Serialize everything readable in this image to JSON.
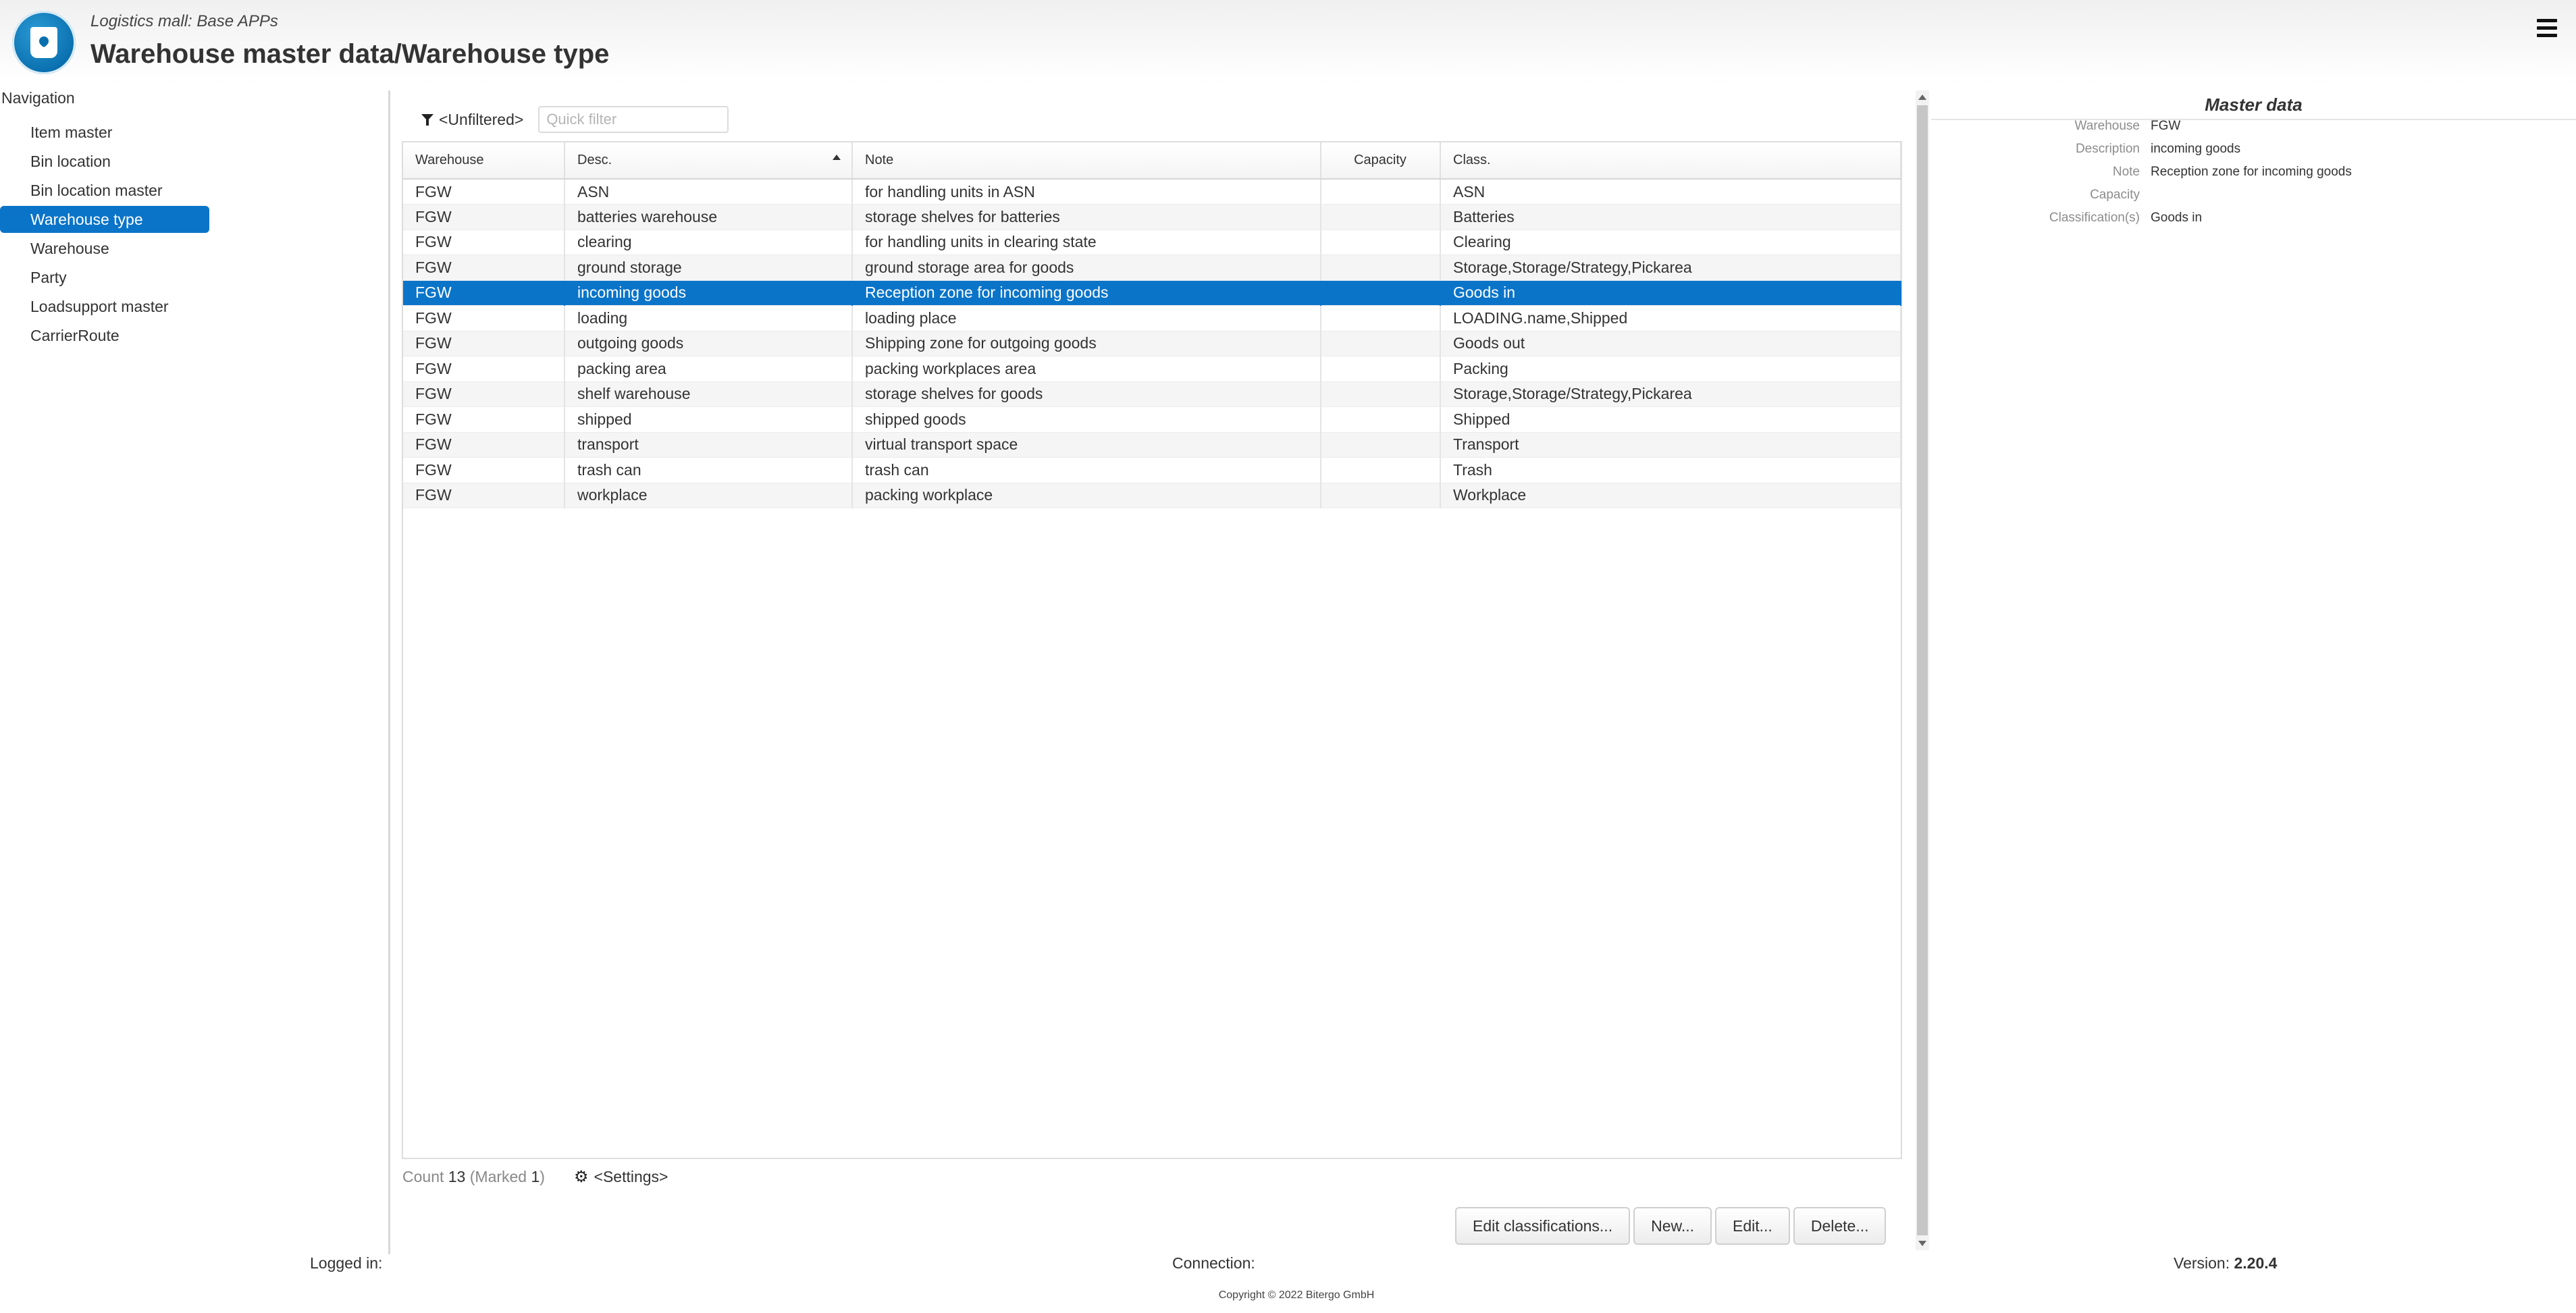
{
  "header": {
    "app_subtitle": "Logistics mall: Base APPs",
    "page_title": "Warehouse master data/Warehouse type",
    "menu_icon": "hamburger-icon",
    "logo_icon": "bitergo-logo"
  },
  "navigation": {
    "title": "Navigation",
    "items": [
      {
        "label": "Item master",
        "active": false
      },
      {
        "label": "Bin location",
        "active": false
      },
      {
        "label": "Bin location master",
        "active": false
      },
      {
        "label": "Warehouse type",
        "active": true
      },
      {
        "label": "Warehouse",
        "active": false
      },
      {
        "label": "Party",
        "active": false
      },
      {
        "label": "Loadsupport master",
        "active": false
      },
      {
        "label": "CarrierRoute",
        "active": false
      }
    ]
  },
  "filter": {
    "label": "<Unfiltered>",
    "quick_filter_placeholder": "Quick filter",
    "quick_filter_value": ""
  },
  "table": {
    "columns": [
      "Warehouse",
      "Desc.",
      "Note",
      "Capacity",
      "Class."
    ],
    "sorted_column": "Desc.",
    "sort_direction": "ascending",
    "rows": [
      {
        "warehouse": "FGW",
        "desc": "ASN",
        "note": "for handling units in ASN",
        "capacity": "",
        "class": "ASN"
      },
      {
        "warehouse": "FGW",
        "desc": "batteries warehouse",
        "note": "storage shelves for batteries",
        "capacity": "",
        "class": "Batteries"
      },
      {
        "warehouse": "FGW",
        "desc": "clearing",
        "note": "for handling units in clearing state",
        "capacity": "",
        "class": "Clearing"
      },
      {
        "warehouse": "FGW",
        "desc": "ground storage",
        "note": "ground storage area for goods",
        "capacity": "",
        "class": "Storage,Storage/Strategy,Pickarea"
      },
      {
        "warehouse": "FGW",
        "desc": "incoming goods",
        "note": "Reception zone for incoming goods",
        "capacity": "",
        "class": "Goods in",
        "selected": true
      },
      {
        "warehouse": "FGW",
        "desc": "loading",
        "note": "loading place",
        "capacity": "",
        "class": "LOADING.name,Shipped"
      },
      {
        "warehouse": "FGW",
        "desc": "outgoing goods",
        "note": "Shipping zone for outgoing goods",
        "capacity": "",
        "class": "Goods out"
      },
      {
        "warehouse": "FGW",
        "desc": "packing area",
        "note": "packing workplaces area",
        "capacity": "",
        "class": "Packing"
      },
      {
        "warehouse": "FGW",
        "desc": "shelf warehouse",
        "note": "storage shelves for goods",
        "capacity": "",
        "class": "Storage,Storage/Strategy,Pickarea"
      },
      {
        "warehouse": "FGW",
        "desc": "shipped",
        "note": "shipped goods",
        "capacity": "",
        "class": "Shipped"
      },
      {
        "warehouse": "FGW",
        "desc": "transport",
        "note": "virtual transport space",
        "capacity": "",
        "class": "Transport"
      },
      {
        "warehouse": "FGW",
        "desc": "trash can",
        "note": "trash can",
        "capacity": "",
        "class": "Trash"
      },
      {
        "warehouse": "FGW",
        "desc": "workplace",
        "note": "packing workplace",
        "capacity": "",
        "class": "Workplace"
      }
    ]
  },
  "footer": {
    "count_label": "Count",
    "count_value": "13",
    "marked_label": "(Marked",
    "marked_value": "1",
    "marked_close": ")",
    "settings_label": "<Settings>"
  },
  "buttons": {
    "edit_classifications": "Edit classifications...",
    "new": "New...",
    "edit": "Edit...",
    "delete": "Delete..."
  },
  "detail": {
    "title": "Master data",
    "fields": [
      {
        "label": "Warehouse",
        "value": "FGW"
      },
      {
        "label": "Description",
        "value": "incoming goods"
      },
      {
        "label": "Note",
        "value": "Reception zone for incoming goods"
      },
      {
        "label": "Capacity",
        "value": ""
      },
      {
        "label": "Classification(s)",
        "value": "Goods in"
      }
    ]
  },
  "status_bar": {
    "logged_in_label": "Logged in:",
    "logged_in_value": "",
    "connection_label": "Connection:",
    "connection_value": "",
    "version_label": "Version:",
    "version_value": "2.20.4",
    "copyright": "Copyright © 2022 Bitergo GmbH"
  },
  "colors": {
    "accent": "#0a74c9",
    "selected_row_bg": "#0a74c9",
    "selected_row_text": "#ffffff",
    "alt_row_bg": "#f5f5f5"
  }
}
